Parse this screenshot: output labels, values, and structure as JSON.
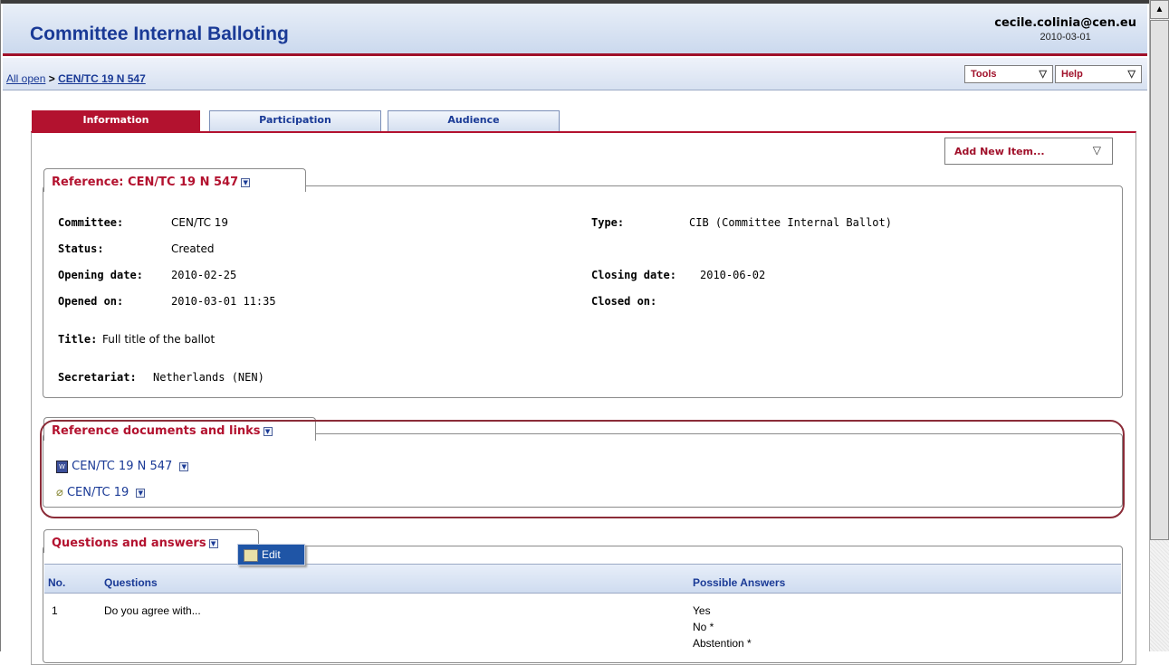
{
  "header": {
    "title": "Committee Internal Balloting",
    "user_email": "cecile.colinia@cen.eu",
    "date": "2010-03-01"
  },
  "breadcrumb": {
    "root": "All open",
    "separator": ">",
    "current": "CEN/TC 19 N 547"
  },
  "menus": {
    "tools": "Tools",
    "help": "Help",
    "add_new": "Add New Item..."
  },
  "tabs": [
    {
      "label": "Information",
      "active": true
    },
    {
      "label": "Participation",
      "active": false
    },
    {
      "label": "Audience",
      "active": false
    }
  ],
  "reference": {
    "title": "Reference: CEN/TC 19 N 547",
    "committee_label": "Committee:",
    "committee": "CEN/TC 19",
    "status_label": "Status:",
    "status": "Created",
    "opening_date_label": "Opening date:",
    "opening_date": "2010-02-25",
    "opened_on_label": "Opened on:",
    "opened_on": "2010-03-01 11:35",
    "type_label": "Type:",
    "type": "CIB (Committee Internal Ballot)",
    "closing_date_label": "Closing date:",
    "closing_date": "2010-06-02",
    "closed_on_label": "Closed on:",
    "closed_on": "",
    "title_label": "Title:",
    "ballot_title": "Full title of the ballot",
    "secretariat_label": "Secretariat:",
    "secretariat": "Netherlands (NEN)"
  },
  "documents": {
    "title": "Reference documents and links",
    "items": [
      {
        "label": "CEN/TC 19 N 547",
        "icon": "document-icon"
      },
      {
        "label": "CEN/TC 19",
        "icon": "link-icon"
      }
    ]
  },
  "qa": {
    "title": "Questions and answers",
    "popup_label": "Edit",
    "columns": {
      "no": "No.",
      "questions": "Questions",
      "answers": "Possible Answers"
    },
    "rows": [
      {
        "no": "1",
        "question": "Do you agree with...",
        "answers": [
          "Yes",
          "No *",
          "Abstention *"
        ]
      }
    ]
  },
  "colors": {
    "accent": "#b3122f",
    "link": "#1a3a96"
  }
}
